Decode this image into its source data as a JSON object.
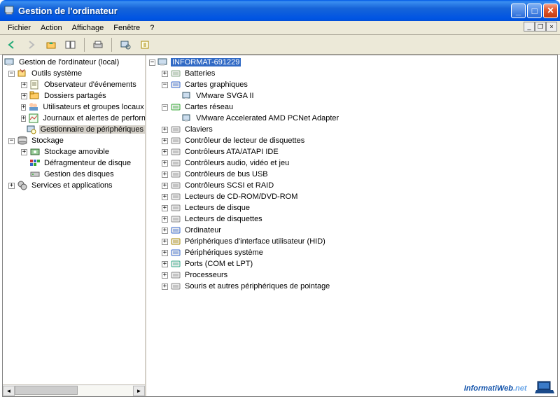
{
  "window": {
    "title": "Gestion de l'ordinateur"
  },
  "menu": {
    "items": [
      "Fichier",
      "Action",
      "Affichage",
      "Fenêtre",
      "?"
    ]
  },
  "left_tree": {
    "root": "Gestion de l'ordinateur (local)",
    "n1": {
      "label": "Outils système",
      "children": {
        "c0": "Observateur d'événements",
        "c1": "Dossiers partagés",
        "c2": "Utilisateurs et groupes locaux",
        "c3": "Journaux et alertes de performances",
        "c4": "Gestionnaire de périphériques"
      }
    },
    "n2": {
      "label": "Stockage",
      "children": {
        "c0": "Stockage amovible",
        "c1": "Défragmenteur de disque",
        "c2": "Gestion des disques"
      }
    },
    "n3": {
      "label": "Services et applications"
    }
  },
  "right_tree": {
    "root": "INFORMAT-691229",
    "items": [
      {
        "label": "Batteries",
        "expanded": false,
        "children": []
      },
      {
        "label": "Cartes graphiques",
        "expanded": true,
        "children": [
          "VMware SVGA II"
        ]
      },
      {
        "label": "Cartes réseau",
        "expanded": true,
        "children": [
          "VMware Accelerated AMD PCNet Adapter"
        ]
      },
      {
        "label": "Claviers",
        "expanded": false,
        "children": []
      },
      {
        "label": "Contrôleur de lecteur de disquettes",
        "expanded": false,
        "children": []
      },
      {
        "label": "Contrôleurs ATA/ATAPI IDE",
        "expanded": false,
        "children": []
      },
      {
        "label": "Contrôleurs audio, vidéo et jeu",
        "expanded": false,
        "children": []
      },
      {
        "label": "Contrôleurs de bus USB",
        "expanded": false,
        "children": []
      },
      {
        "label": "Contrôleurs SCSI et RAID",
        "expanded": false,
        "children": []
      },
      {
        "label": "Lecteurs de CD-ROM/DVD-ROM",
        "expanded": false,
        "children": []
      },
      {
        "label": "Lecteurs de disque",
        "expanded": false,
        "children": []
      },
      {
        "label": "Lecteurs de disquettes",
        "expanded": false,
        "children": []
      },
      {
        "label": "Ordinateur",
        "expanded": false,
        "children": []
      },
      {
        "label": "Périphériques d'interface utilisateur (HID)",
        "expanded": false,
        "children": []
      },
      {
        "label": "Périphériques système",
        "expanded": false,
        "children": []
      },
      {
        "label": "Ports (COM et LPT)",
        "expanded": false,
        "children": []
      },
      {
        "label": "Processeurs",
        "expanded": false,
        "children": []
      },
      {
        "label": "Souris et autres périphériques de pointage",
        "expanded": false,
        "children": []
      }
    ]
  },
  "watermark": {
    "a": "Informati",
    "b": "Web",
    "c": ".net"
  }
}
